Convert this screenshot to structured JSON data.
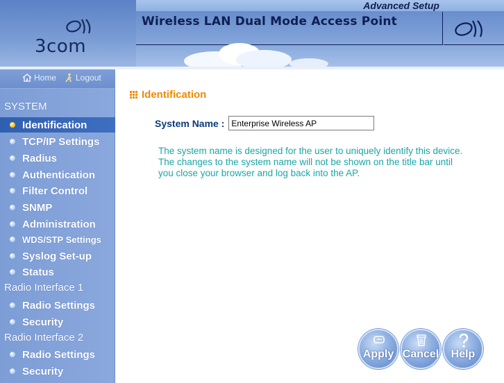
{
  "header": {
    "brand": "3com",
    "advanced_setup": "Advanced Setup",
    "title": "Wireless LAN Dual Mode Access Point"
  },
  "topnav": {
    "home": "Home",
    "logout": "Logout"
  },
  "sidebar": {
    "system_heading": "SYSTEM",
    "system_items": [
      {
        "label": "Identification",
        "active": true
      },
      {
        "label": "TCP/IP Settings"
      },
      {
        "label": "Radius"
      },
      {
        "label": "Authentication"
      },
      {
        "label": "Filter Control"
      },
      {
        "label": "SNMP"
      },
      {
        "label": "Administration"
      },
      {
        "label": "WDS/STP Settings"
      },
      {
        "label": "Syslog Set-up"
      },
      {
        "label": "Status"
      }
    ],
    "radio1_heading": "Radio Interface 1",
    "radio1_items": [
      {
        "label": "Radio Settings"
      },
      {
        "label": "Security"
      }
    ],
    "radio2_heading": "Radio Interface 2",
    "radio2_items": [
      {
        "label": "Radio Settings"
      },
      {
        "label": "Security"
      }
    ]
  },
  "main": {
    "section_title": "Identification",
    "system_name_label": "System Name :",
    "system_name_value": "Enterprise Wireless AP",
    "description": "The system name is designed for the user to uniquely identify this device. The changes to the system name will not be shown on the title bar until you close your browser and log back into the AP."
  },
  "buttons": {
    "apply": "Apply",
    "cancel": "Cancel",
    "help": "Help"
  },
  "colors": {
    "accent_orange": "#ee8a00",
    "sidebar_blue": "#8aa8dd",
    "description_teal": "#1aa5a5",
    "label_navy": "#0a3a7a",
    "active_bullet": "#ffcc33"
  },
  "icons": {
    "home": "home-icon",
    "logout": "person-walking-icon",
    "section": "grid-dots-icon",
    "apply": "hand-pointer-icon",
    "cancel": "trash-bin-icon",
    "help": "question-mark-icon"
  }
}
